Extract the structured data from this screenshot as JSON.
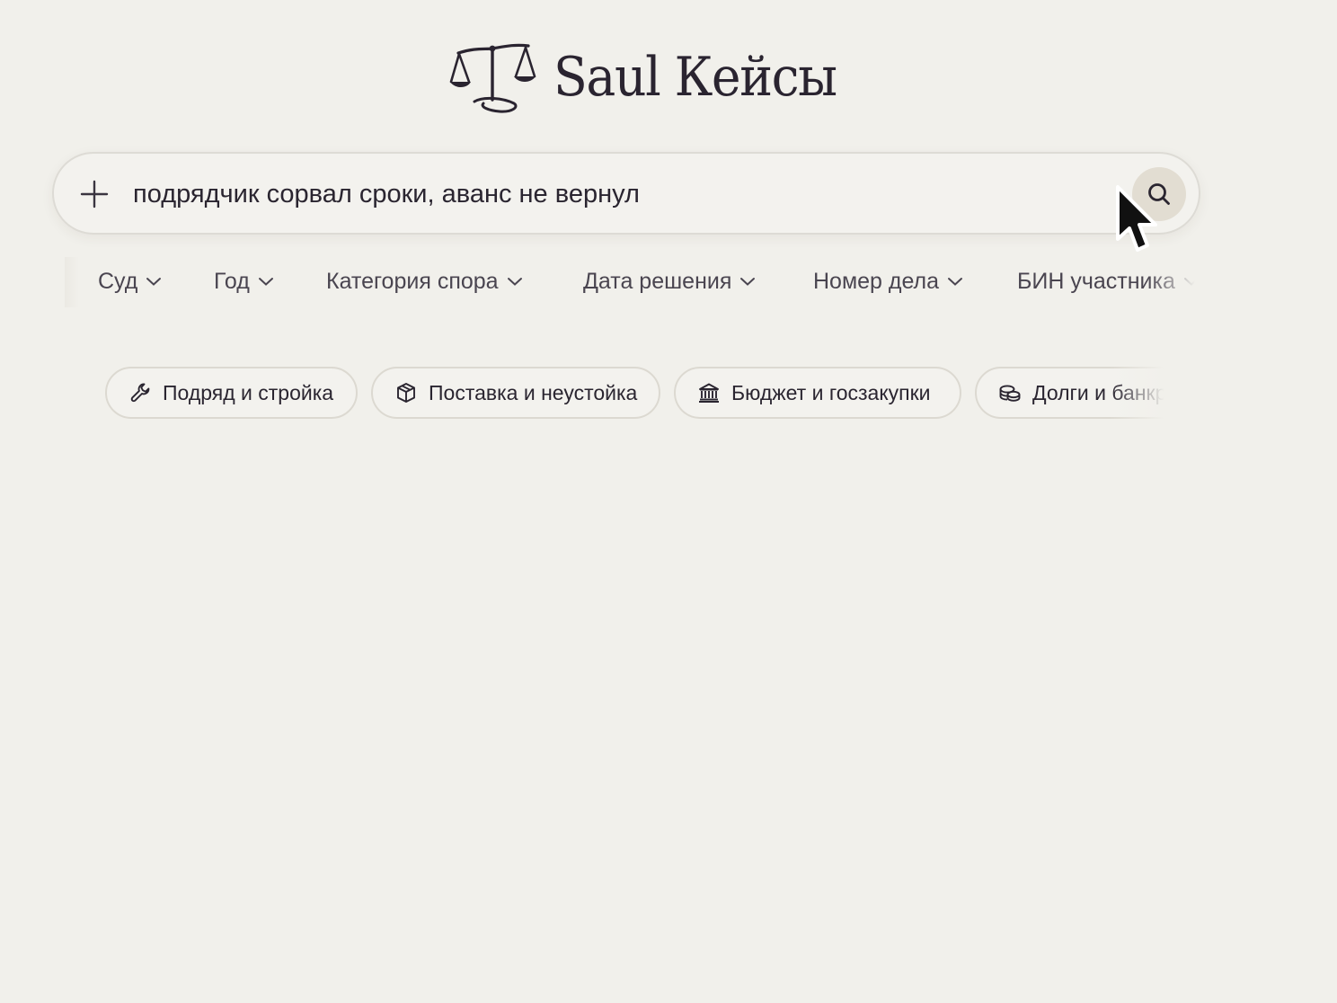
{
  "brand": {
    "name": "Saul Кейсы",
    "logo_icon": "scales-of-justice-icon"
  },
  "search": {
    "value": "подрядчик сорвал сроки, аванс не вернул",
    "placeholder": "",
    "add_icon": "plus-icon",
    "submit_icon": "search-icon"
  },
  "filters": [
    {
      "label": "Суд"
    },
    {
      "label": "Год"
    },
    {
      "label": "Категория спора"
    },
    {
      "label": "Дата решения"
    },
    {
      "label": "Номер дела"
    },
    {
      "label": "БИН участника"
    }
  ],
  "categories": [
    {
      "label": "Подряд и стройка",
      "icon": "wrench-icon"
    },
    {
      "label": "Поставка и неустойка",
      "icon": "package-icon"
    },
    {
      "label": "Бюджет и госзакупки",
      "icon": "bank-icon"
    },
    {
      "label": "Долги и банкротство",
      "icon": "coins-icon"
    }
  ],
  "colors": {
    "background": "#f1f0eb",
    "text": "#2a2530",
    "muted_text": "#4a4550",
    "border": "#dcd9d1",
    "search_button": "#e2ddd2"
  }
}
